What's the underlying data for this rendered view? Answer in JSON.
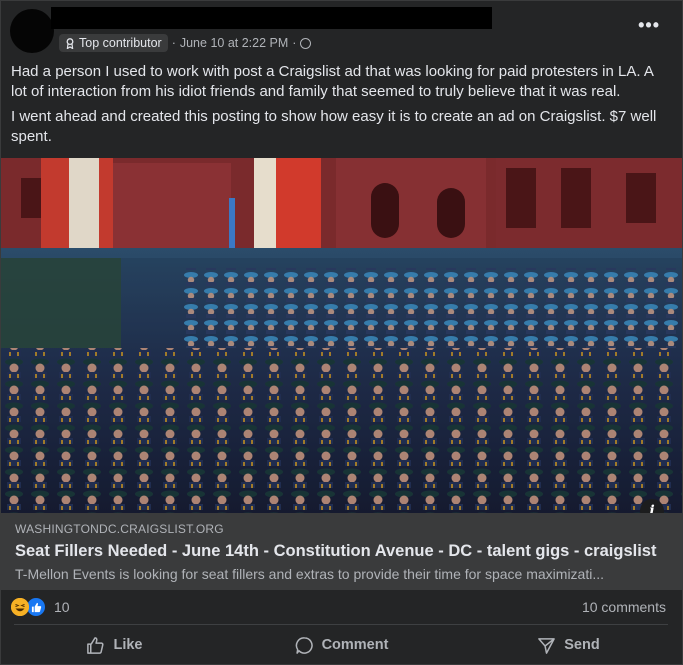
{
  "post": {
    "badge_label": "Top contributor",
    "separator": "·",
    "timestamp": "June 10 at 2:22 PM",
    "separator2": "·",
    "more_label": "•••",
    "paragraphs": [
      "Had a person I used to work with post a Craigslist ad that was looking for paid protesters in LA. A lot of interaction from his idiot friends and family that seemed to truly believe that it was real.",
      "I went ahead and created this posting to show how easy it is to create an ad on Craigslist. $7 well spent."
    ]
  },
  "link_preview": {
    "domain": "WASHINGTONDC.CRAIGSLIST.ORG",
    "title": "Seat Fillers Needed - June 14th - Constitution Avenue - DC - talent gigs - craigslist",
    "description": "T-Mellon Events is looking for seat fillers and extras to provide their time for space maximizati...",
    "info_label": "i"
  },
  "stats": {
    "reaction_count": "10",
    "comments_label": "10 comments"
  },
  "actions": {
    "like": "Like",
    "comment": "Comment",
    "send": "Send"
  },
  "icons": {
    "badge": "contributor-badge-icon",
    "audience": "globe-icon",
    "reaction1": "haha-reaction-icon",
    "reaction2": "like-reaction-icon"
  },
  "colors": {
    "card_bg": "#242526",
    "link_bg": "#3a3b3c",
    "text_primary": "#e4e6eb",
    "text_secondary": "#b0b3b8",
    "like_blue": "#1877f2"
  }
}
